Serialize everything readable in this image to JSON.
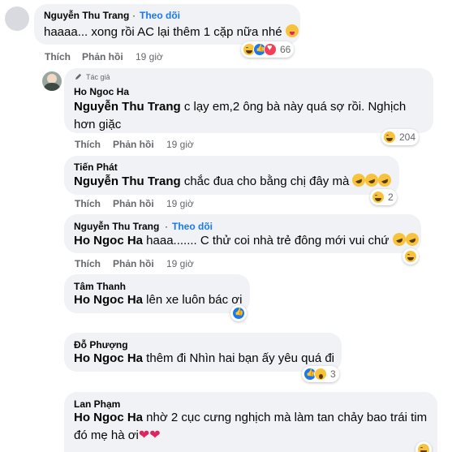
{
  "comments": [
    {
      "author": "Nguyễn Thu Trang",
      "follow_label": "Theo dõi",
      "text": "haaaa... xong rồi AC lại thêm 1 cặp nữa nhé",
      "actions": {
        "like": "Thích",
        "reply": "Phản hồi",
        "time": "19 giờ"
      },
      "reactions": {
        "icons": [
          "haha-icon",
          "like-icon",
          "love-icon"
        ],
        "count": "66"
      }
    }
  ],
  "replies": [
    {
      "author_badge": "Tác giả",
      "author": "Ho Ngoc Ha",
      "mention": "Nguyễn Thu Trang",
      "text": " c lạy em,2 ông bà này quá sợ rồi. Nghịch hơn giặc",
      "actions": {
        "like": "Thích",
        "reply": "Phản hồi",
        "time": "19 giờ"
      },
      "reactions": {
        "icons": [
          "haha-icon"
        ],
        "count": "204"
      }
    },
    {
      "author": "Tiến Phát",
      "mention": "Nguyễn Thu Trang",
      "text": " chắc đua cho bằng chị đây mà",
      "actions": {
        "like": "Thích",
        "reply": "Phản hồi",
        "time": "19 giờ"
      },
      "reactions": {
        "icons": [
          "haha-icon"
        ],
        "count": "2"
      }
    },
    {
      "author": "Nguyễn Thu Trang",
      "follow_label": "Theo dõi",
      "mention": "Ho Ngoc Ha",
      "text": " haaa....... C thử coi nhà trẻ đông mới vui chứ",
      "actions": {
        "like": "Thích",
        "reply": "Phản hồi",
        "time": "19 giờ"
      },
      "reactions": {
        "icons": [
          "haha-icon"
        ]
      }
    },
    {
      "author": "Tâm Thanh",
      "mention": "Ho Ngoc Ha",
      "text": " lên xe luôn bác ơi",
      "reactions": {
        "icons": [
          "like-icon"
        ]
      }
    },
    {
      "author": "Đỗ Phượng",
      "mention": "Ho Ngoc Ha",
      "text": " thêm đi Nhìn hai bạn ấy yêu quá đi",
      "reactions": {
        "icons": [
          "like-icon",
          "wow-icon"
        ],
        "count": "3"
      }
    },
    {
      "author": "Lan Phạm",
      "mention": "Ho Ngoc Ha",
      "text": " nhờ 2 cục cưng nghịch mà làm tan chảy bao trái tim",
      "text2": "đó mẹ hà ơi",
      "reactions": {
        "icons": [
          "haha-icon"
        ]
      }
    }
  ]
}
